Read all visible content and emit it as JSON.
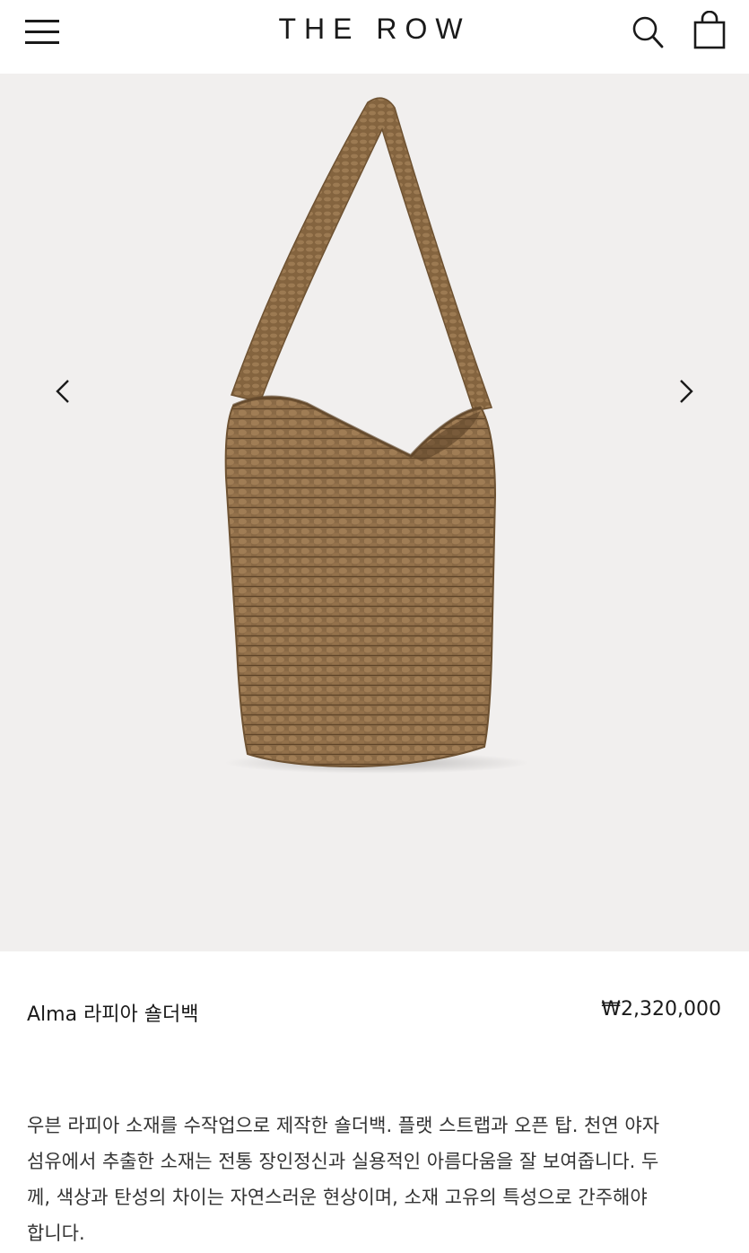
{
  "header": {
    "brand": "THE ROW",
    "menu_icon": "hamburger-menu-icon",
    "search_icon": "search-icon",
    "bag_icon": "shopping-bag-icon"
  },
  "gallery": {
    "image": "woven-raffia-shoulder-bag-photo",
    "prev_icon": "chevron-left-icon",
    "next_icon": "chevron-right-icon",
    "background": "#f1efee"
  },
  "product": {
    "name": "Alma 라피아 숄더백",
    "price": "₩2,320,000",
    "description_lines": [
      "우븐 라피아 소재를 수작업으로 제작한 숄더백. 플랫 스트랩과 오픈 탑. 천연 야자",
      "섬유에서 추출한 소재는 전통 장인정신과 실용적인 아름다움을 잘 보여줍니다. 두",
      "께, 색상과 탄성의 차이는 자연스러운 현상이며, 소재 고유의 특성으로 간주해야",
      "합니다."
    ]
  },
  "colors": {
    "text": "#1a1a1a",
    "raffia": "#8a6a46",
    "raffia_dark": "#6e5232"
  }
}
